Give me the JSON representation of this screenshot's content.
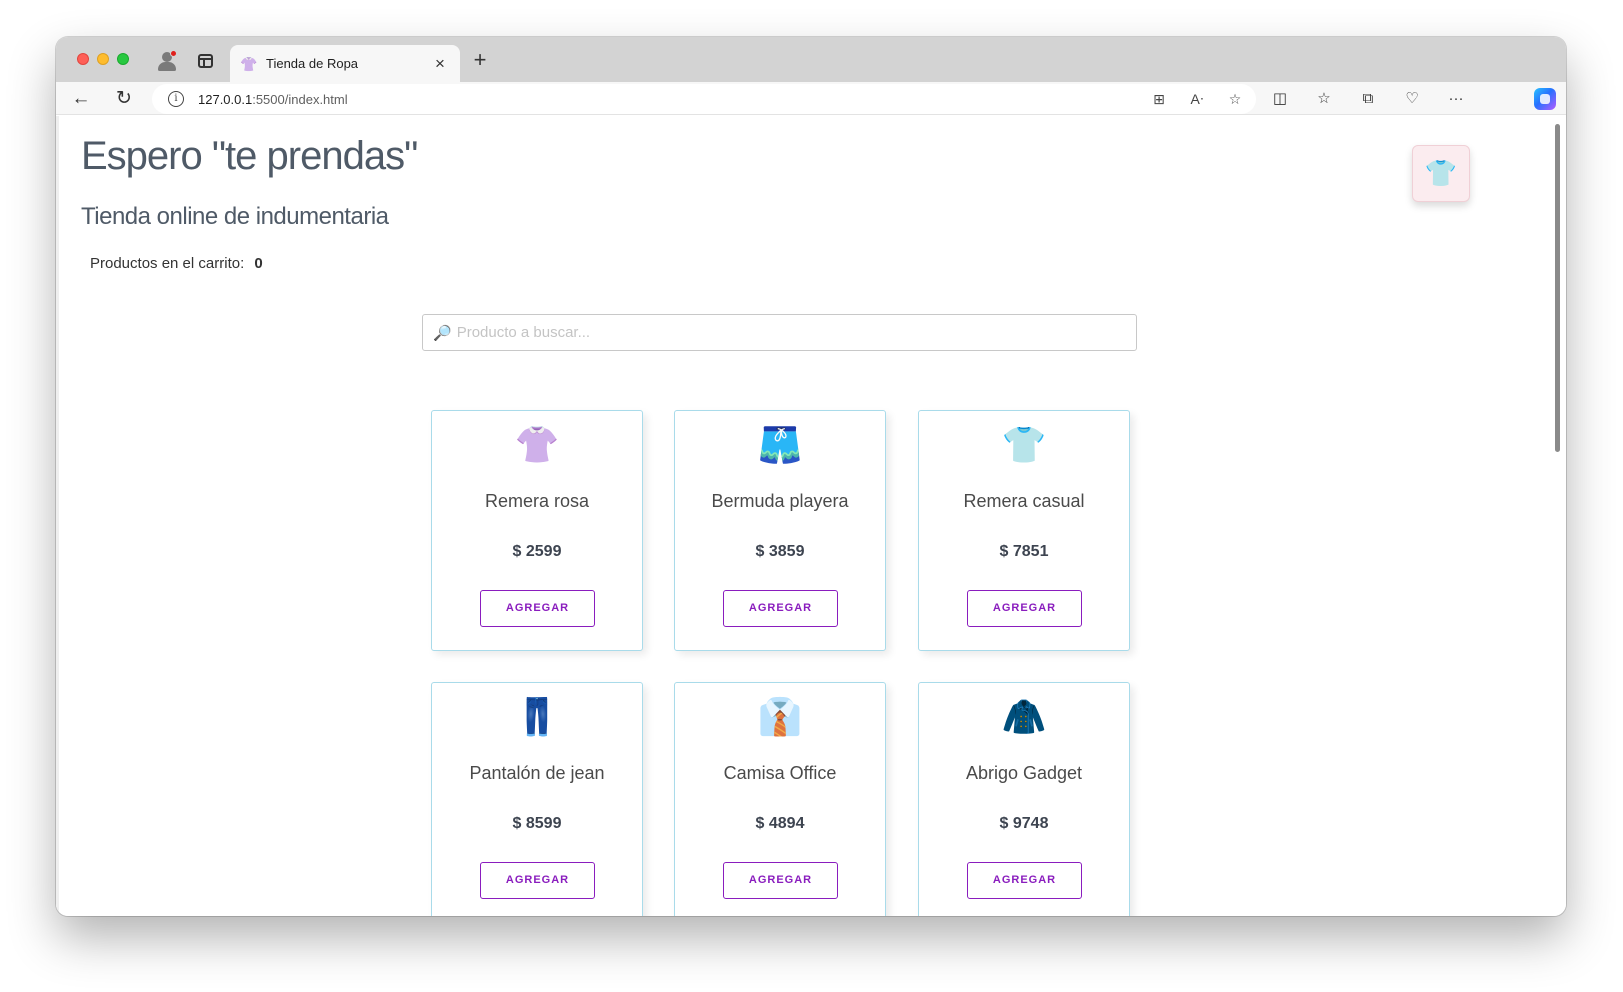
{
  "browser": {
    "tab": {
      "title": "Tienda de Ropa",
      "favicon": "👚",
      "close_label": "×"
    },
    "new_tab_label": "+",
    "nav": {
      "back": "←",
      "reload": "↻"
    },
    "url_host": "127.0.0.1",
    "url_rest": ":5500/index.html",
    "omni_icons": [
      "⊞",
      "Aᐧ",
      "☆"
    ],
    "tool_icons": [
      "◫",
      "☆",
      "⧉",
      "♡",
      "···"
    ]
  },
  "page": {
    "title": "Espero \"te prendas\"",
    "subtitle": "Tienda online de indumentaria",
    "cart_label": "Productos en el carrito:",
    "cart_count": "0",
    "cart_button_icon": "👕"
  },
  "search": {
    "placeholder": "Producto a buscar...",
    "icon": "🔎"
  },
  "products": [
    {
      "emoji": "👚",
      "name": "Remera rosa",
      "price": "$ 2599",
      "button": "AGREGAR"
    },
    {
      "emoji": "🩳",
      "name": "Bermuda playera",
      "price": "$ 3859",
      "button": "AGREGAR"
    },
    {
      "emoji": "👕",
      "name": "Remera casual",
      "price": "$ 7851",
      "button": "AGREGAR"
    },
    {
      "emoji": "👖",
      "name": "Pantalón de jean",
      "price": "$ 8599",
      "button": "AGREGAR"
    },
    {
      "emoji": "👔",
      "name": "Camisa Office",
      "price": "$ 4894",
      "button": "AGREGAR"
    },
    {
      "emoji": "🧥",
      "name": "Abrigo Gadget",
      "price": "$ 9748",
      "button": "AGREGAR"
    }
  ],
  "colors": {
    "accent": "#8a1dbe",
    "card_border": "#a9dbea",
    "heading": "#4f5a67"
  }
}
